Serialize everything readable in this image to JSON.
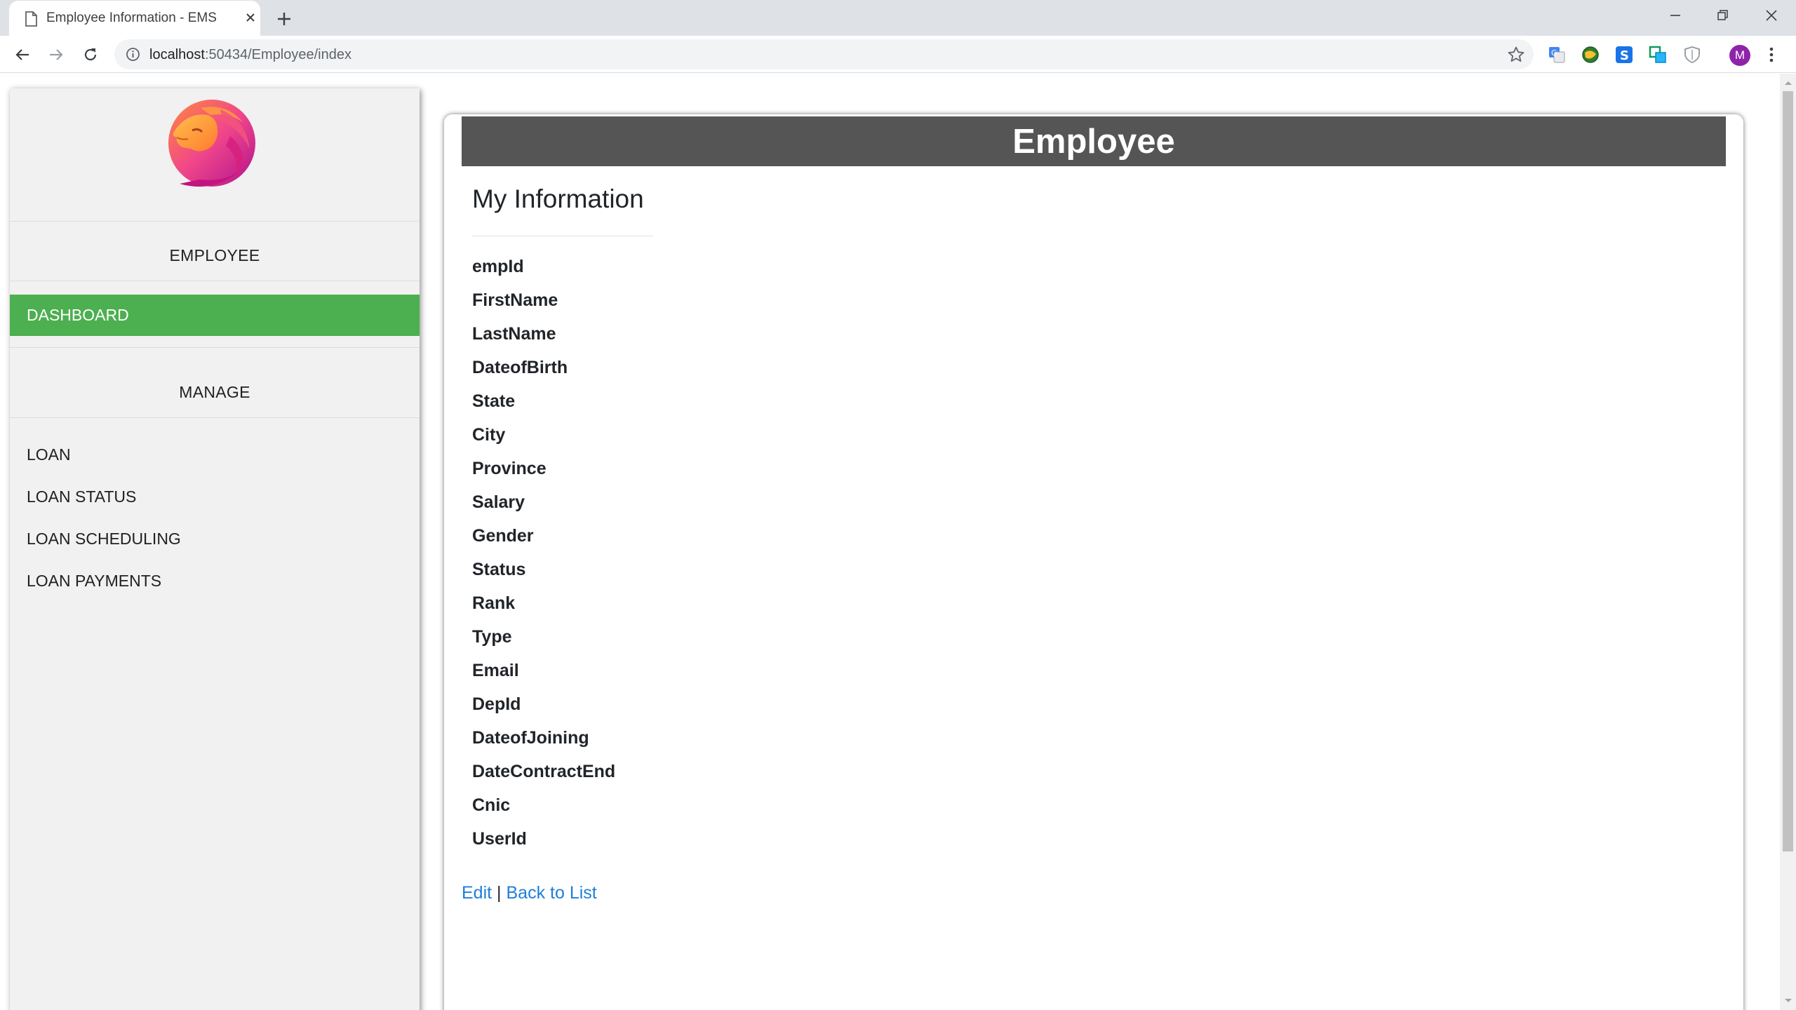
{
  "browser": {
    "tab_title": "Employee Information - EMS",
    "url_host": "localhost",
    "url_rest": ":50434/Employee/index",
    "avatar_letter": "M"
  },
  "sidebar": {
    "section_employee": "EMPLOYEE",
    "active_item": "DASHBOARD",
    "section_manage": "MANAGE",
    "links": [
      "LOAN",
      "LOAN STATUS",
      "LOAN SCHEDULING",
      "LOAN PAYMENTS"
    ],
    "active_color": "#4caf50"
  },
  "main": {
    "header": "Employee",
    "section_title": "My Information",
    "fields": [
      "empId",
      "FirstName",
      "LastName",
      "DateofBirth",
      "State",
      "City",
      "Province",
      "Salary",
      "Gender",
      "Status",
      "Rank",
      "Type",
      "Email",
      "DepId",
      "DateofJoining",
      "DateContractEnd",
      "Cnic",
      "UserId"
    ],
    "edit_link": "Edit",
    "separator": "|",
    "back_link": "Back to List"
  },
  "icons": [
    "page-icon",
    "close-icon",
    "plus-icon",
    "minimize-icon",
    "restore-icon",
    "window-close-icon",
    "back-arrow-icon",
    "forward-arrow-icon",
    "reload-icon",
    "info-icon",
    "star-icon",
    "translate-icon",
    "globe-extension-icon",
    "s-extension-icon",
    "copy-extension-icon",
    "shield-icon",
    "menu-dots-icon",
    "lion-logo"
  ]
}
